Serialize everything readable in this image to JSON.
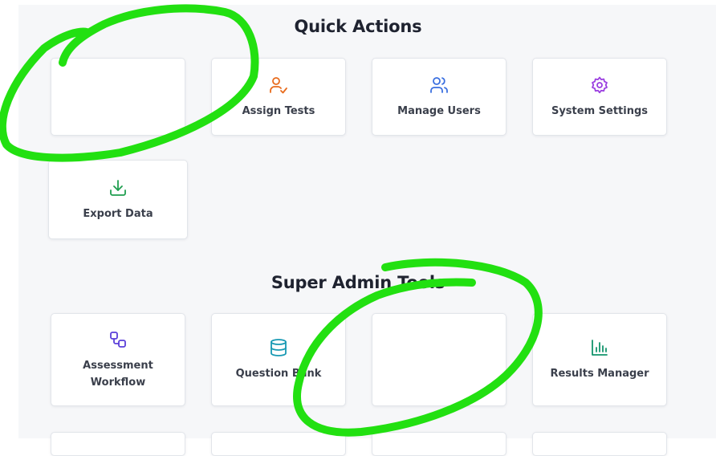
{
  "quick_actions": {
    "title": "Quick Actions",
    "cards": [
      {
        "label": "",
        "icon": "none"
      },
      {
        "label": "Assign Tests",
        "icon": "user-check-icon",
        "color": "#e86b1c"
      },
      {
        "label": "Manage Users",
        "icon": "users-icon",
        "color": "#3a6fe0"
      },
      {
        "label": "System Settings",
        "icon": "gear-icon",
        "color": "#9b3fe0"
      },
      {
        "label": "Export Data",
        "icon": "download-icon",
        "color": "#1f9e4f"
      }
    ]
  },
  "super_admin_tools": {
    "title": "Super Admin Tools",
    "cards": [
      {
        "label": "Assessment Workflow",
        "icon": "workflow-icon",
        "color": "#5b3fd9"
      },
      {
        "label": "Question Bank",
        "icon": "database-icon",
        "color": "#1899b3"
      },
      {
        "label": "",
        "icon": "none"
      },
      {
        "label": "Results Manager",
        "icon": "bar-chart-icon",
        "color": "#12946c"
      }
    ]
  },
  "annotation_color": "#22e011"
}
